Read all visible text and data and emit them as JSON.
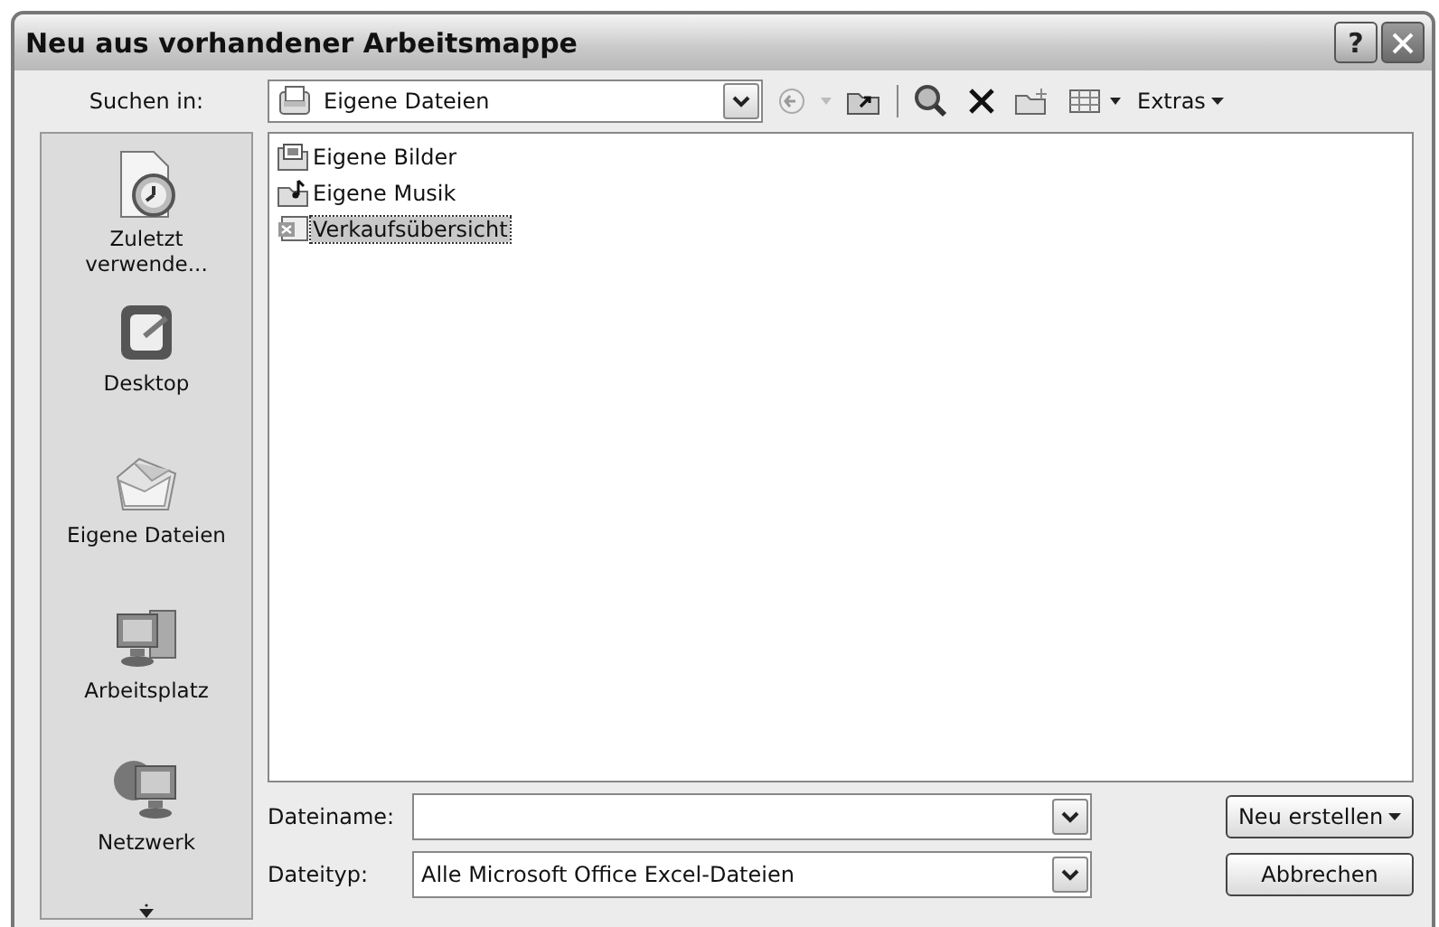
{
  "window": {
    "title": "Neu aus vorhandener Arbeitsmappe",
    "help": "?"
  },
  "toolbar": {
    "look_in_label": "Suchen in:",
    "location": "Eigene Dateien",
    "extras": "Extras"
  },
  "places": [
    {
      "kind": "recent",
      "label": "Zuletzt verwende..."
    },
    {
      "kind": "desktop",
      "label": "Desktop"
    },
    {
      "kind": "documents",
      "label": "Eigene Dateien"
    },
    {
      "kind": "computer",
      "label": "Arbeitsplatz"
    },
    {
      "kind": "network",
      "label": "Netzwerk"
    }
  ],
  "files": [
    {
      "kind": "pictures",
      "name": "Eigene Bilder",
      "selected": false
    },
    {
      "kind": "music",
      "name": "Eigene Musik",
      "selected": false
    },
    {
      "kind": "workbook",
      "name": "Verkaufsübersicht",
      "selected": true
    }
  ],
  "filename": {
    "label": "Dateiname:"
  },
  "filetype": {
    "label": "Dateityp:",
    "value": "Alle Microsoft Office Excel-Dateien"
  },
  "buttons": {
    "create": "Neu erstellen",
    "cancel": "Abbrechen"
  }
}
